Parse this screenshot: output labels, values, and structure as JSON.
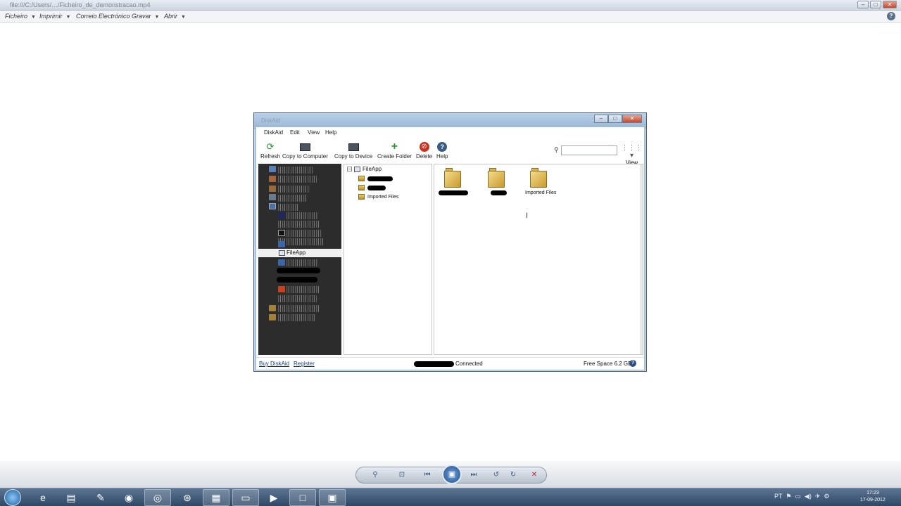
{
  "viewer": {
    "title": "file:///C:/Users/…/Ficheiro_de_demonstracao.mp4",
    "menu": [
      {
        "label": "Ficheiro"
      },
      {
        "label": "Imprimir"
      },
      {
        "label": "Correio Electrónico"
      },
      {
        "label": "Gravar"
      },
      {
        "label": "Abrir"
      }
    ]
  },
  "app": {
    "title": "DiskAid",
    "menu": [
      {
        "label": "DiskAid"
      },
      {
        "label": "Edit"
      },
      {
        "label": "View"
      },
      {
        "label": "Help"
      }
    ],
    "toolbar": {
      "refresh": "Refresh",
      "copy_to_computer": "Copy to Computer",
      "copy_to_device": "Copy to Device",
      "create_folder": "Create Folder",
      "delete": "Delete",
      "help": "Help",
      "view": "View",
      "search_value": "",
      "search_placeholder": ""
    },
    "left_pane": {
      "selected_item": "FileApp"
    },
    "middle_pane": {
      "root": "FileApp",
      "items": [
        {
          "label": ""
        },
        {
          "label": ""
        },
        {
          "label": "Imported Files"
        }
      ]
    },
    "right_pane": {
      "folders": [
        {
          "label": ""
        },
        {
          "label": ""
        },
        {
          "label": "Imported Files"
        }
      ]
    },
    "status": {
      "buy": "Buy DiskAid",
      "register": "Register",
      "connected": "Connected",
      "free_space": "Free Space 6.2 GB"
    }
  },
  "taskbar": {
    "time": "17:23",
    "date": "17-09-2012"
  }
}
